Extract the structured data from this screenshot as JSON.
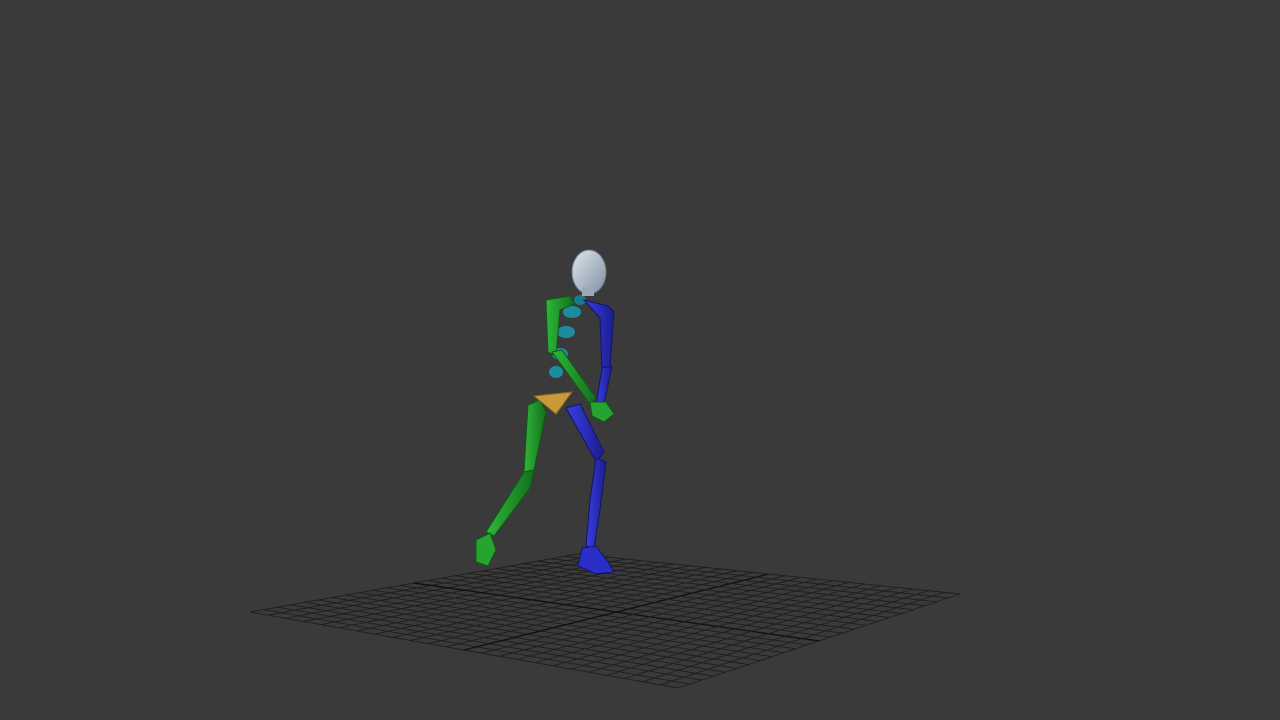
{
  "viewport": {
    "background_color": "#3a3a3a",
    "grid_color": "#1e1e1e",
    "grid_axis_color": "#111111"
  },
  "biped": {
    "head_color": "#b8c6d6",
    "left_side_color": "#1f9a2a",
    "right_side_color": "#2a2ec8",
    "spine_color": "#1e8ca0",
    "pelvis_color": "#c89a3a"
  }
}
